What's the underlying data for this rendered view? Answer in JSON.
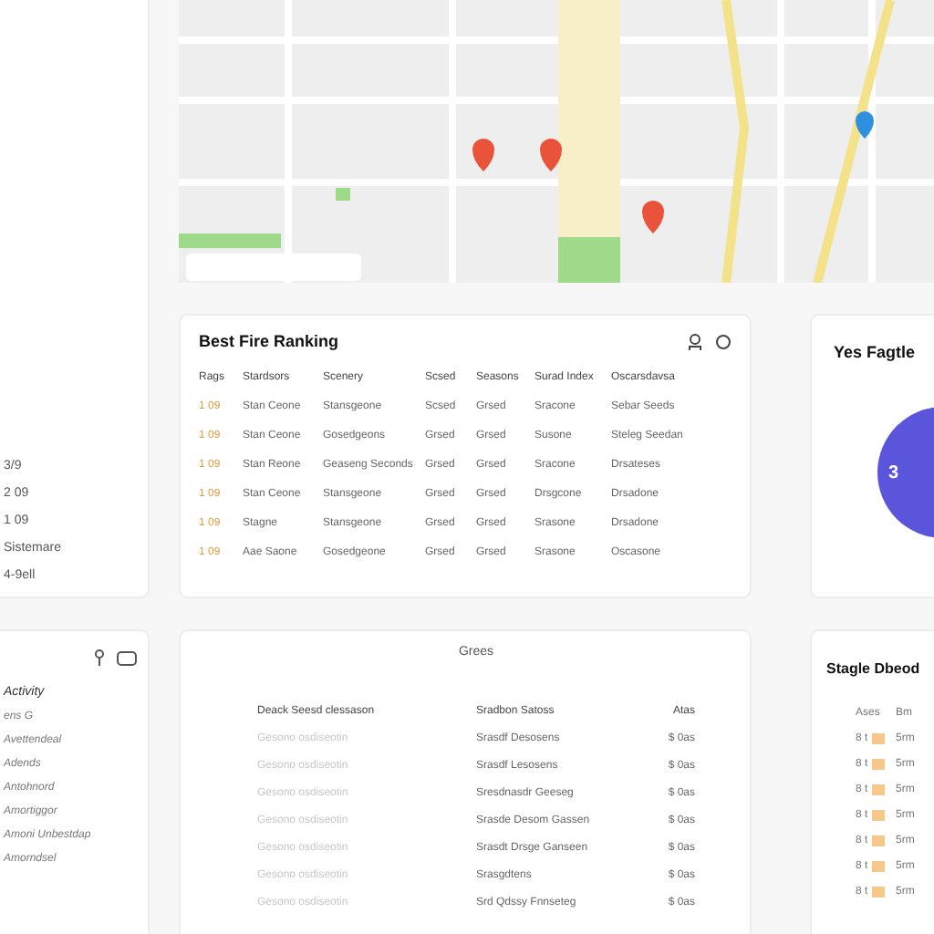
{
  "sidebar_top": {
    "items": [
      "3/9",
      "2 09",
      "1 09",
      "Sistemare",
      "4-9ell"
    ]
  },
  "sidebar_panel": {
    "heading": "Activity",
    "items": [
      "ens G",
      "Avettendeal",
      "Adends",
      "Antohnord",
      "Amortiggor",
      "Amoni Unbestdap",
      "Amorndsel"
    ]
  },
  "ranking": {
    "title": "Best Fire Ranking",
    "columns": [
      "Rags",
      "Stardsors",
      "Scenery",
      "Scsed",
      "Seasons",
      "Surad Index",
      "Oscarsdavsa"
    ],
    "rows": [
      [
        "1 09",
        "Stan Ceone",
        "Stansgeone",
        "Scsed",
        "Grsed",
        "Sracone",
        "Sebar Seeds"
      ],
      [
        "1 09",
        "Stan Ceone",
        "Gosedgeons",
        "Grsed",
        "Grsed",
        "Susone",
        "Steleg Seedan"
      ],
      [
        "1 09",
        "Stan Reone",
        "Geaseng Seconds",
        "Grsed",
        "Grsed",
        "Sracone",
        "Drsateses"
      ],
      [
        "1 09",
        "Stan Ceone",
        "Stansgeone",
        "Grsed",
        "Grsed",
        "Drsgcone",
        "Drsadone"
      ],
      [
        "1 09",
        "Stagne",
        "Stansgeone",
        "Grsed",
        "Grsed",
        "Srasone",
        "Drsadone"
      ],
      [
        "1 09",
        "Aae Saone",
        "Gosedgeone",
        "Grsed",
        "Grsed",
        "Srasone",
        "Oscasone"
      ]
    ]
  },
  "summary": {
    "title": "Grees",
    "columns": [
      "Deack Seesd clessason",
      "Sradbon Satoss",
      "Atas"
    ],
    "rows": [
      [
        "Gesono osdiseotin",
        "Srasdf Desosens",
        "$ 0as"
      ],
      [
        "Gesono osdiseotin",
        "Srasdf Lesosens",
        "$ 0as"
      ],
      [
        "Gesono osdiseotin",
        "Sresdnasdr Geeseg",
        "$ 0as"
      ],
      [
        "Gesono osdiseotin",
        "Srasde Desom Gassen",
        "$ 0as"
      ],
      [
        "Gesono osdiseotin",
        "Srasdt Drsge Ganseen",
        "$ 0as"
      ],
      [
        "Gesono osdiseotin",
        "Srasgdtens",
        "$ 0as"
      ],
      [
        "Gesono osdiseotin",
        "Srd Qdssy Fnnseteg",
        "$ 0as"
      ]
    ]
  },
  "profile": {
    "title": "Yes Fagtle",
    "avatar_text": "3"
  },
  "side_table": {
    "title": "Stagle Dbeod",
    "columns": [
      "Ases",
      "Bm"
    ],
    "rows": [
      [
        "8 t",
        "5rm"
      ],
      [
        "8 t",
        "5rm"
      ],
      [
        "8 t",
        "5rm"
      ],
      [
        "8 t",
        "5rm"
      ],
      [
        "8 t",
        "5rm"
      ],
      [
        "8 t",
        "5rm"
      ],
      [
        "8 t",
        "5rm"
      ]
    ]
  }
}
